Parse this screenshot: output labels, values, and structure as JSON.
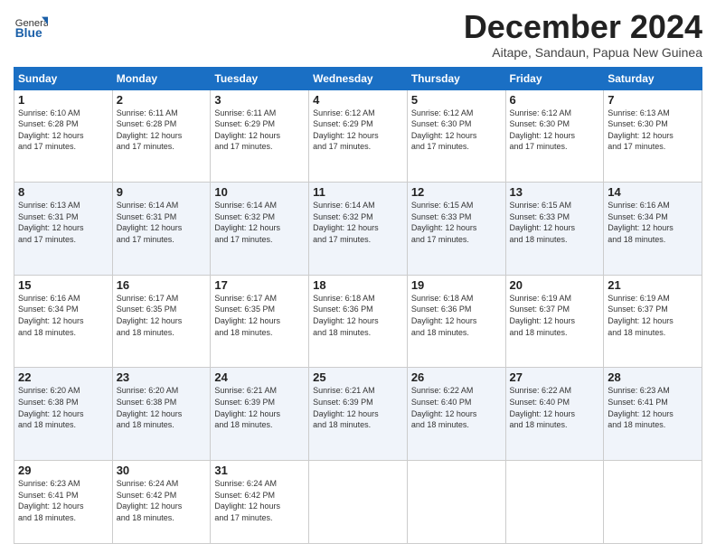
{
  "logo": {
    "general": "General",
    "blue": "Blue"
  },
  "title": "December 2024",
  "subtitle": "Aitape, Sandaun, Papua New Guinea",
  "days_header": [
    "Sunday",
    "Monday",
    "Tuesday",
    "Wednesday",
    "Thursday",
    "Friday",
    "Saturday"
  ],
  "weeks": [
    [
      {
        "day": 1,
        "info": "Sunrise: 6:10 AM\nSunset: 6:28 PM\nDaylight: 12 hours\nand 17 minutes."
      },
      {
        "day": 2,
        "info": "Sunrise: 6:11 AM\nSunset: 6:28 PM\nDaylight: 12 hours\nand 17 minutes."
      },
      {
        "day": 3,
        "info": "Sunrise: 6:11 AM\nSunset: 6:29 PM\nDaylight: 12 hours\nand 17 minutes."
      },
      {
        "day": 4,
        "info": "Sunrise: 6:12 AM\nSunset: 6:29 PM\nDaylight: 12 hours\nand 17 minutes."
      },
      {
        "day": 5,
        "info": "Sunrise: 6:12 AM\nSunset: 6:30 PM\nDaylight: 12 hours\nand 17 minutes."
      },
      {
        "day": 6,
        "info": "Sunrise: 6:12 AM\nSunset: 6:30 PM\nDaylight: 12 hours\nand 17 minutes."
      },
      {
        "day": 7,
        "info": "Sunrise: 6:13 AM\nSunset: 6:30 PM\nDaylight: 12 hours\nand 17 minutes."
      }
    ],
    [
      {
        "day": 8,
        "info": "Sunrise: 6:13 AM\nSunset: 6:31 PM\nDaylight: 12 hours\nand 17 minutes."
      },
      {
        "day": 9,
        "info": "Sunrise: 6:14 AM\nSunset: 6:31 PM\nDaylight: 12 hours\nand 17 minutes."
      },
      {
        "day": 10,
        "info": "Sunrise: 6:14 AM\nSunset: 6:32 PM\nDaylight: 12 hours\nand 17 minutes."
      },
      {
        "day": 11,
        "info": "Sunrise: 6:14 AM\nSunset: 6:32 PM\nDaylight: 12 hours\nand 17 minutes."
      },
      {
        "day": 12,
        "info": "Sunrise: 6:15 AM\nSunset: 6:33 PM\nDaylight: 12 hours\nand 17 minutes."
      },
      {
        "day": 13,
        "info": "Sunrise: 6:15 AM\nSunset: 6:33 PM\nDaylight: 12 hours\nand 18 minutes."
      },
      {
        "day": 14,
        "info": "Sunrise: 6:16 AM\nSunset: 6:34 PM\nDaylight: 12 hours\nand 18 minutes."
      }
    ],
    [
      {
        "day": 15,
        "info": "Sunrise: 6:16 AM\nSunset: 6:34 PM\nDaylight: 12 hours\nand 18 minutes."
      },
      {
        "day": 16,
        "info": "Sunrise: 6:17 AM\nSunset: 6:35 PM\nDaylight: 12 hours\nand 18 minutes."
      },
      {
        "day": 17,
        "info": "Sunrise: 6:17 AM\nSunset: 6:35 PM\nDaylight: 12 hours\nand 18 minutes."
      },
      {
        "day": 18,
        "info": "Sunrise: 6:18 AM\nSunset: 6:36 PM\nDaylight: 12 hours\nand 18 minutes."
      },
      {
        "day": 19,
        "info": "Sunrise: 6:18 AM\nSunset: 6:36 PM\nDaylight: 12 hours\nand 18 minutes."
      },
      {
        "day": 20,
        "info": "Sunrise: 6:19 AM\nSunset: 6:37 PM\nDaylight: 12 hours\nand 18 minutes."
      },
      {
        "day": 21,
        "info": "Sunrise: 6:19 AM\nSunset: 6:37 PM\nDaylight: 12 hours\nand 18 minutes."
      }
    ],
    [
      {
        "day": 22,
        "info": "Sunrise: 6:20 AM\nSunset: 6:38 PM\nDaylight: 12 hours\nand 18 minutes."
      },
      {
        "day": 23,
        "info": "Sunrise: 6:20 AM\nSunset: 6:38 PM\nDaylight: 12 hours\nand 18 minutes."
      },
      {
        "day": 24,
        "info": "Sunrise: 6:21 AM\nSunset: 6:39 PM\nDaylight: 12 hours\nand 18 minutes."
      },
      {
        "day": 25,
        "info": "Sunrise: 6:21 AM\nSunset: 6:39 PM\nDaylight: 12 hours\nand 18 minutes."
      },
      {
        "day": 26,
        "info": "Sunrise: 6:22 AM\nSunset: 6:40 PM\nDaylight: 12 hours\nand 18 minutes."
      },
      {
        "day": 27,
        "info": "Sunrise: 6:22 AM\nSunset: 6:40 PM\nDaylight: 12 hours\nand 18 minutes."
      },
      {
        "day": 28,
        "info": "Sunrise: 6:23 AM\nSunset: 6:41 PM\nDaylight: 12 hours\nand 18 minutes."
      }
    ],
    [
      {
        "day": 29,
        "info": "Sunrise: 6:23 AM\nSunset: 6:41 PM\nDaylight: 12 hours\nand 18 minutes."
      },
      {
        "day": 30,
        "info": "Sunrise: 6:24 AM\nSunset: 6:42 PM\nDaylight: 12 hours\nand 18 minutes."
      },
      {
        "day": 31,
        "info": "Sunrise: 6:24 AM\nSunset: 6:42 PM\nDaylight: 12 hours\nand 17 minutes."
      },
      null,
      null,
      null,
      null
    ]
  ]
}
